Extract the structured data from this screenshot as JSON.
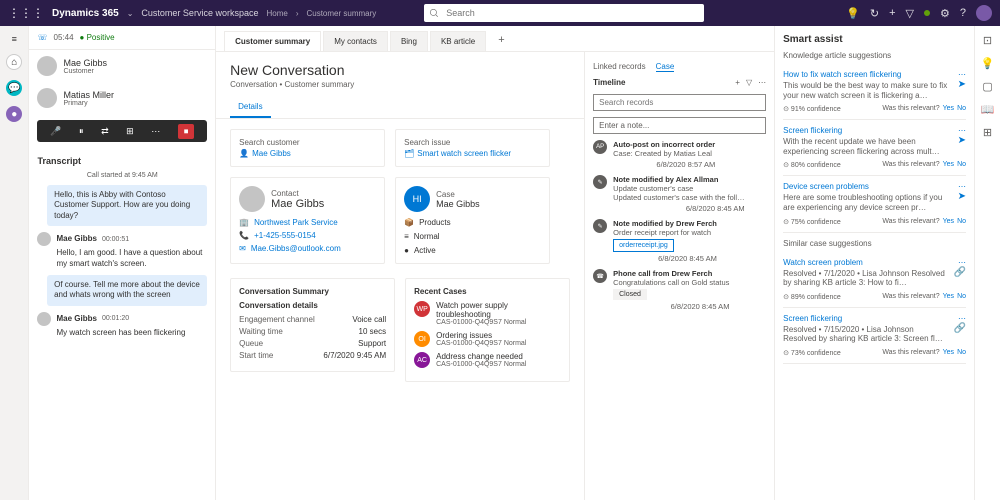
{
  "topbar": {
    "brand": "Dynamics 365",
    "workspace": "Customer Service workspace",
    "breadcrumb": [
      "Home",
      "Customer summary"
    ],
    "searchPlaceholder": "Search"
  },
  "leftcol": {
    "callTime": "05:44",
    "sentiment": "Positive",
    "parties": [
      {
        "name": "Mae Gibbs",
        "role": "Customer"
      },
      {
        "name": "Matias Miller",
        "role": "Primary"
      }
    ],
    "transcriptLabel": "Transcript",
    "callStarted": "Call started at 9:45 AM",
    "messages": [
      {
        "who": "agent",
        "text": "Hello, this is Abby with Contoso Customer Support. How are you doing today?"
      },
      {
        "who": "cust",
        "name": "Mae Gibbs",
        "ts": "00:00:51",
        "text": "Hello, I am good. I have a question about my smart watch's screen."
      },
      {
        "who": "agent",
        "text": "Of course. Tell me more about the device and whats wrong with the screen"
      },
      {
        "who": "cust",
        "name": "Mae Gibbs",
        "ts": "00:01:20",
        "text": "My watch screen has been flickering"
      }
    ]
  },
  "tabs": [
    "Customer summary",
    "My contacts",
    "Bing",
    "KB article"
  ],
  "conversation": {
    "title": "New Conversation",
    "subtitle": "Conversation • Customer summary",
    "detailsTab": "Details"
  },
  "searchCustomer": {
    "label": "Search customer",
    "value": "Mae Gibbs"
  },
  "searchIssue": {
    "label": "Search issue",
    "value": "Smart watch screen flicker"
  },
  "contact": {
    "label": "Contact",
    "name": "Mae Gibbs",
    "org": "Northwest Park Service",
    "phone": "+1-425-555-0154",
    "email": "Mae.Gibbs@outlook.com"
  },
  "case": {
    "label": "Case",
    "name": "Mae Gibbs",
    "product": "Products",
    "priority": "Normal",
    "status": "Active"
  },
  "convSummary": {
    "title": "Conversation Summary",
    "detailsTitle": "Conversation details",
    "rows": [
      {
        "k": "Engagement channel",
        "v": "Voice call"
      },
      {
        "k": "Waiting time",
        "v": "10 secs"
      },
      {
        "k": "Queue",
        "v": "Support"
      },
      {
        "k": "Start time",
        "v": "6/7/2020 9:45 AM"
      }
    ]
  },
  "recentCases": {
    "title": "Recent Cases",
    "items": [
      {
        "badge": "WP",
        "cls": "b1",
        "title": "Watch power supply troubleshooting",
        "meta": "CAS-01000-Q4Q9S7 Normal"
      },
      {
        "badge": "OI",
        "cls": "b2",
        "title": "Ordering issues",
        "meta": "CAS-01000-Q4Q9S7 Normal"
      },
      {
        "badge": "AC",
        "cls": "b3",
        "title": "Address change needed",
        "meta": "CAS-01000-Q4Q9S7 Normal"
      }
    ]
  },
  "linked": {
    "tabs": [
      "Linked records",
      "Case"
    ],
    "timelineLabel": "Timeline",
    "searchPlaceholder": "Search records",
    "notePlaceholder": "Enter a note...",
    "items": [
      {
        "icon": "AP",
        "title": "Auto-post on incorrect order",
        "desc": "Case: Created by Matias Leal",
        "ts": "6/8/2020 8:57 AM"
      },
      {
        "icon": "✎",
        "title": "Note modified by Alex Allman",
        "desc": "Update customer's case",
        "desc2": "Updated customer's case with the foll…",
        "ts": "6/8/2020 8:45 AM"
      },
      {
        "icon": "✎",
        "title": "Note modified by Drew Ferch",
        "desc": "Order receipt report for watch",
        "attach": "orderreceipt.jpg",
        "ts": "6/8/2020 8:45 AM"
      },
      {
        "icon": "☎",
        "title": "Phone call from Drew Ferch",
        "desc": "Congratulations call on Gold status",
        "closed": "Closed",
        "ts": "6/8/2020 8:45 AM"
      }
    ]
  },
  "smartAssist": {
    "title": "Smart assist",
    "kbSection": "Knowledge article suggestions",
    "caseSection": "Similar case suggestions",
    "relevantLabel": "Was this relevant?",
    "yes": "Yes",
    "no": "No",
    "kb": [
      {
        "t": "How to fix watch screen flickering",
        "d": "This would be the best way to make sure to fix your new watch screen it is flickering a…",
        "conf": "91% confidence"
      },
      {
        "t": "Screen flickering",
        "d": "With the recent update we have been experiencing screen flickering across mult…",
        "conf": "80% confidence"
      },
      {
        "t": "Device screen problems",
        "d": "Here are some troubleshooting options if you are experiencing any device screen pr…",
        "conf": "75% confidence"
      }
    ],
    "cases": [
      {
        "t": "Watch screen problem",
        "d": "Resolved • 7/1/2020 • Lisa Johnson Resolved by sharing KB article 3: How to fi…",
        "conf": "89% confidence"
      },
      {
        "t": "Screen flickering",
        "d": "Resolved • 7/15/2020 • Lisa Johnson Resolved by sharing KB article 3: Screen fl…",
        "conf": "73% confidence"
      }
    ]
  }
}
